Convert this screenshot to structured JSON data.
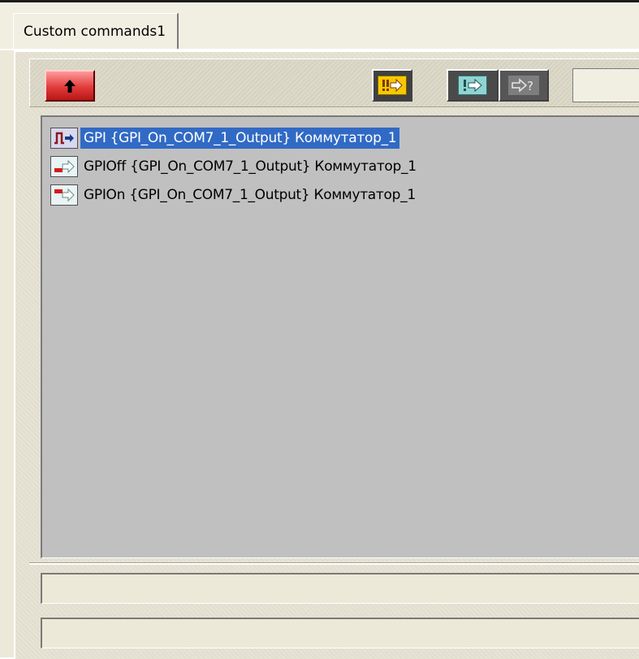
{
  "tab": {
    "label": "Custom commands1"
  },
  "toolbar": {
    "buttons": [
      {
        "icon": "up-arrow-icon"
      },
      {
        "icon": "execute-all-icon",
        "face": "!⇨"
      },
      {
        "icon": "execute-selected-icon",
        "face": "!⇨"
      },
      {
        "icon": "query-icon",
        "face": "⇨?"
      }
    ]
  },
  "commands": [
    {
      "label": "GPI {GPI_On_COM7_1_Output} Коммутатор_1",
      "icon": "gpi-pulse-icon",
      "selected": true
    },
    {
      "label": "GPIOff {GPI_On_COM7_1_Output} Коммутатор_1",
      "icon": "gpi-off-icon",
      "selected": false
    },
    {
      "label": "GPIOn {GPI_On_COM7_1_Output} Коммутатор_1",
      "icon": "gpi-on-icon",
      "selected": false
    }
  ],
  "fields": [
    {
      "value": ""
    },
    {
      "value": ""
    }
  ],
  "colors": {
    "selection": "#316ac5",
    "list_background": "#c0c0c0",
    "up_button": "#e23c3c",
    "execute_all": "#f7c800",
    "execute_selected": "#8fd3d3"
  }
}
